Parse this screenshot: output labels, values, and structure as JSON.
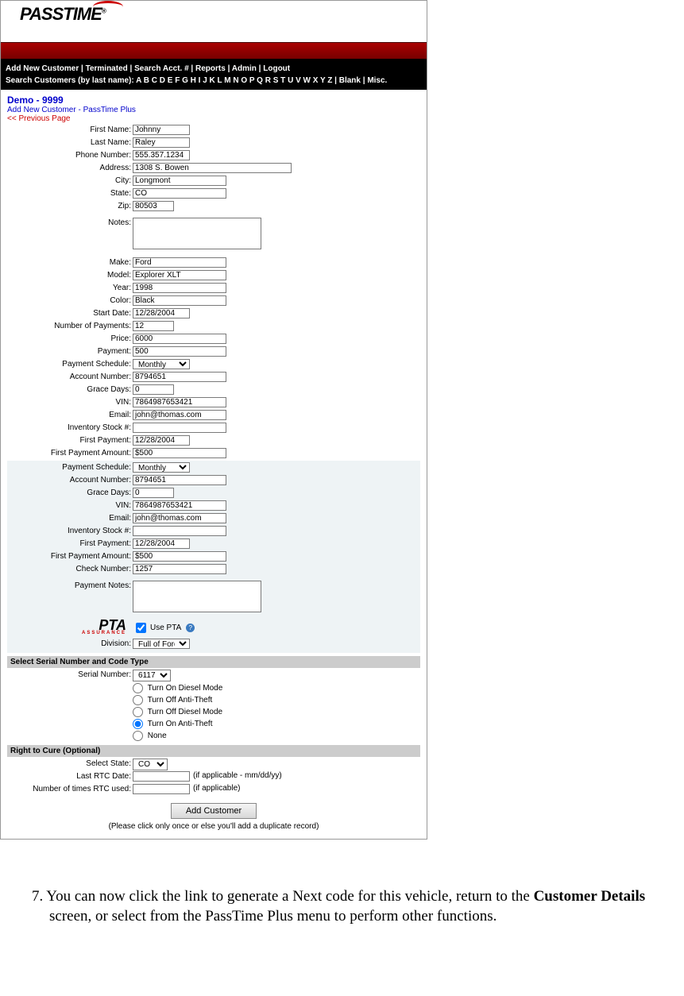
{
  "logo": "PASSTIME",
  "nav": {
    "line1": "Add New Customer | Terminated | Search Acct. # | Reports | Admin | Logout",
    "line2": "Search Customers (by last name): A B C D E F G H I J K L M N O P Q R S T U V W X Y Z | Blank | Misc."
  },
  "dealer": "Demo - 9999",
  "subtitle": "Add New Customer - PassTime Plus",
  "prev_link": "<< Previous Page",
  "customer": {
    "first_name": {
      "label": "First Name:",
      "value": "Johnny"
    },
    "last_name": {
      "label": "Last Name:",
      "value": "Raley"
    },
    "phone": {
      "label": "Phone Number:",
      "value": "555.357.1234"
    },
    "address": {
      "label": "Address:",
      "value": "1308 S. Bowen"
    },
    "city": {
      "label": "City:",
      "value": "Longmont"
    },
    "state": {
      "label": "State:",
      "value": "CO"
    },
    "zip": {
      "label": "Zip:",
      "value": "80503"
    },
    "notes": {
      "label": "Notes:",
      "value": ""
    }
  },
  "vehicle": {
    "make": {
      "label": "Make:",
      "value": "Ford"
    },
    "model": {
      "label": "Model:",
      "value": "Explorer XLT"
    },
    "year": {
      "label": "Year:",
      "value": "1998"
    },
    "color": {
      "label": "Color:",
      "value": "Black"
    },
    "start_date": {
      "label": "Start Date:",
      "value": "12/28/2004"
    },
    "num_payments": {
      "label": "Number of Payments:",
      "value": "12"
    },
    "price": {
      "label": "Price:",
      "value": "6000"
    },
    "payment": {
      "label": "Payment:",
      "value": "500"
    },
    "schedule": {
      "label": "Payment Schedule:",
      "value": "Monthly"
    },
    "account": {
      "label": "Account Number:",
      "value": "8794651"
    },
    "grace": {
      "label": "Grace Days:",
      "value": "0"
    },
    "vin": {
      "label": "VIN:",
      "value": "7864987653421"
    },
    "email": {
      "label": "Email:",
      "value": "john@thomas.com"
    },
    "stock": {
      "label": "Inventory Stock #:",
      "value": ""
    },
    "first_payment": {
      "label": "First Payment:",
      "value": "12/28/2004"
    },
    "first_amount": {
      "label": "First Payment Amount:",
      "value": "$500"
    }
  },
  "payment2": {
    "schedule": {
      "label": "Payment Schedule:",
      "value": "Monthly"
    },
    "account": {
      "label": "Account Number:",
      "value": "8794651"
    },
    "grace": {
      "label": "Grace Days:",
      "value": "0"
    },
    "vin": {
      "label": "VIN:",
      "value": "7864987653421"
    },
    "email": {
      "label": "Email:",
      "value": "john@thomas.com"
    },
    "stock": {
      "label": "Inventory Stock #:",
      "value": ""
    },
    "first_payment": {
      "label": "First Payment:",
      "value": "12/28/2004"
    },
    "first_amount": {
      "label": "First Payment Amount:",
      "value": "$500"
    },
    "check": {
      "label": "Check Number:",
      "value": "1257"
    },
    "notes": {
      "label": "Payment Notes:",
      "value": ""
    }
  },
  "pta": {
    "logo_main": "PTA",
    "logo_sub": "ASSURANCE",
    "checkbox_label": "Use PTA"
  },
  "division": {
    "label": "Division:",
    "value": "Full of Fords"
  },
  "serial_section": {
    "header": "Select Serial Number and Code Type",
    "serial": {
      "label": "Serial Number:",
      "value": "6117"
    },
    "options": [
      "Turn On Diesel Mode",
      "Turn Off Anti-Theft",
      "Turn Off Diesel Mode",
      "Turn On Anti-Theft",
      "None"
    ],
    "selected_index": 3
  },
  "rtc_section": {
    "header": "Right to Cure (Optional)",
    "state": {
      "label": "Select State:",
      "value": "CO"
    },
    "last_date": {
      "label": "Last RTC Date:",
      "value": "",
      "hint": "(if applicable - mm/dd/yy)"
    },
    "times": {
      "label": "Number of times RTC used:",
      "value": "",
      "hint": "(if applicable)"
    }
  },
  "submit_label": "Add Customer",
  "footer_note": "(Please click only once or else you'll add a duplicate record)",
  "instruction": {
    "num": "7.",
    "text1": "You can now click the link to generate a Next code for this vehicle, return to the ",
    "bold": "Customer Details",
    "text2": " screen, or select from the PassTime Plus menu to perform other functions."
  }
}
